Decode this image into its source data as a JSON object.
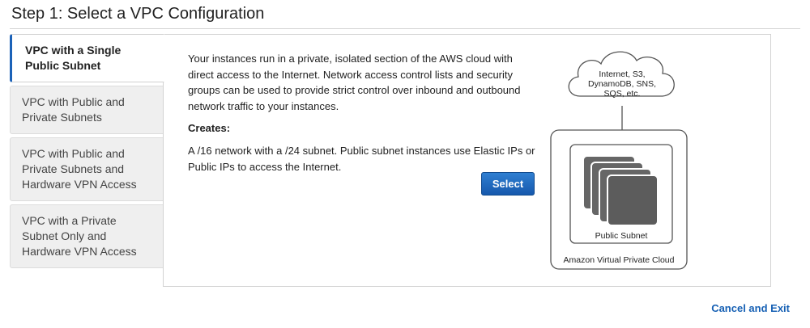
{
  "page": {
    "title": "Step 1: Select a VPC Configuration"
  },
  "options": [
    {
      "label": "VPC with a Single Public Subnet",
      "selected": true
    },
    {
      "label": "VPC with Public and Private Subnets",
      "selected": false
    },
    {
      "label": "VPC with Public and Private Subnets and Hardware VPN Access",
      "selected": false
    },
    {
      "label": "VPC with a Private Subnet Only and Hardware VPN Access",
      "selected": false
    }
  ],
  "detail": {
    "description": "Your instances run in a private, isolated section of the AWS cloud with direct access to the Internet. Network access control lists and security groups can be used to provide strict control over inbound and outbound network traffic to your instances.",
    "creates_label": "Creates:",
    "creates_text": "A /16 network with a /24 subnet. Public subnet instances use Elastic IPs or Public IPs to access the Internet.",
    "select_label": "Select"
  },
  "diagram": {
    "cloud_lines": [
      "Internet, S3,",
      "DynamoDB, SNS,",
      "SQS, etc."
    ],
    "subnet_label": "Public Subnet",
    "vpc_label": "Amazon Virtual Private Cloud"
  },
  "footer": {
    "cancel_label": "Cancel and Exit"
  },
  "colors": {
    "accent": "#1b62b8",
    "link": "#1660b4",
    "button": "#1f6ac2"
  }
}
